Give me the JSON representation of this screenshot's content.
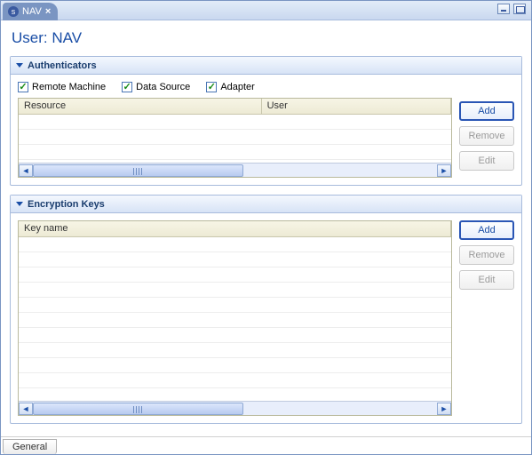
{
  "tab": {
    "label": "NAV"
  },
  "page_title": "User: NAV",
  "authenticators": {
    "title": "Authenticators",
    "checks": {
      "remote_machine": {
        "label": "Remote Machine",
        "checked": true
      },
      "data_source": {
        "label": "Data Source",
        "checked": true
      },
      "adapter": {
        "label": "Adapter",
        "checked": true
      }
    },
    "columns": {
      "resource": "Resource",
      "user": "User"
    },
    "buttons": {
      "add": "Add",
      "remove": "Remove",
      "edit": "Edit"
    }
  },
  "encryption": {
    "title": "Encryption Keys",
    "columns": {
      "key_name": "Key name"
    },
    "buttons": {
      "add": "Add",
      "remove": "Remove",
      "edit": "Edit"
    }
  },
  "bottom_tab": {
    "general": "General"
  }
}
